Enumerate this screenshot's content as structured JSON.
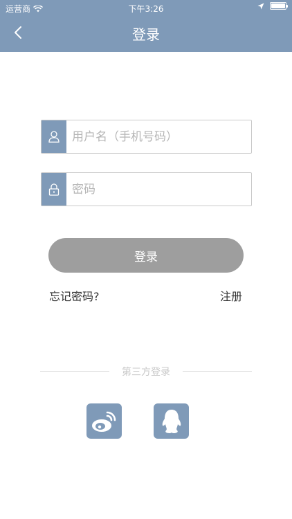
{
  "status_bar": {
    "carrier": "运营商",
    "time": "下午3:26"
  },
  "nav": {
    "title": "登录"
  },
  "form": {
    "username_placeholder": "用户名（手机号码）",
    "password_placeholder": "密码",
    "login_label": "登录",
    "forgot_label": "忘记密码?",
    "register_label": "注册"
  },
  "third_party": {
    "label": "第三方登录",
    "providers": [
      "weibo-icon",
      "qq-icon"
    ]
  },
  "colors": {
    "accent": "#7f9ab8",
    "button_disabled": "#9e9e9e"
  }
}
